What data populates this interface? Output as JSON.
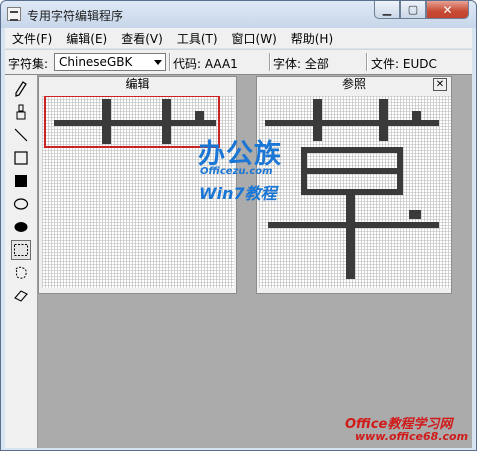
{
  "window": {
    "title": "专用字符编辑程序",
    "controls": {
      "minimize": "▁",
      "maximize": "▢",
      "close": "✕"
    }
  },
  "menubar": [
    {
      "label": "文件(F)"
    },
    {
      "label": "编辑(E)"
    },
    {
      "label": "查看(V)"
    },
    {
      "label": "工具(T)"
    },
    {
      "label": "窗口(W)"
    },
    {
      "label": "帮助(H)"
    }
  ],
  "infobar": {
    "charset_label": "字符集:",
    "charset_value": "ChineseGBK",
    "code": "代码: AAA1",
    "font": "字体: 全部",
    "file": "文件: EUDC"
  },
  "toolbox": [
    {
      "icon": "pencil-icon",
      "glyph": "✎"
    },
    {
      "icon": "brush-icon",
      "glyph": "♙"
    },
    {
      "icon": "line-icon",
      "glyph": "╲"
    },
    {
      "icon": "hollow-rectangle-icon",
      "glyph": "□"
    },
    {
      "icon": "filled-rectangle-icon",
      "glyph": "■"
    },
    {
      "icon": "hollow-ellipse-icon",
      "glyph": "○"
    },
    {
      "icon": "filled-ellipse-icon",
      "glyph": "●"
    },
    {
      "icon": "rectangle-select-icon",
      "glyph": "⬚",
      "active": true
    },
    {
      "icon": "freeform-select-icon",
      "glyph": "☁"
    },
    {
      "icon": "eraser-icon",
      "glyph": "◇"
    }
  ],
  "edit_panel": {
    "title": "编辑"
  },
  "reference_panel": {
    "title": "参照",
    "close": "✕"
  },
  "colors": {
    "grid_line": "#b8b8b8",
    "pixel_on": "#3a3a3a",
    "selection": "#cc2222"
  },
  "watermark": {
    "line1": "办公族",
    "line2": "Officezu.com",
    "line3": "Win7教程",
    "footer1": "Office教程学习网",
    "footer2": "www.office68.com"
  }
}
